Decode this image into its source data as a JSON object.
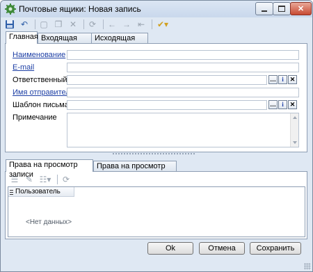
{
  "window": {
    "title": "Почтовые ящики: Новая запись"
  },
  "toolbar": {
    "icons": [
      "save-icon",
      "undo-icon",
      "new-icon",
      "copy-icon",
      "delete-icon",
      "refresh-icon",
      "back-icon",
      "forward-icon",
      "jump-icon",
      "check-icon"
    ]
  },
  "main_tabs": [
    "Главная",
    "Входящая почта",
    "Исходящая почта"
  ],
  "fields": {
    "name_label": "Наименование",
    "email_label": "E-mail",
    "responsible_label": "Ответственный",
    "sender_label": "Имя отправителя",
    "template_label": "Шаблон письма",
    "note_label": "Примечание",
    "values": {
      "name": "",
      "email": "",
      "responsible": "",
      "sender": "",
      "template": "",
      "note": ""
    }
  },
  "lookup_buttons": {
    "ellipsis": "…",
    "info": "i",
    "clear": "✕"
  },
  "detail_tabs": [
    "Права на просмотр записи",
    "Права на просмотр записи"
  ],
  "grid": {
    "column": "Пользователь",
    "empty_text": "<Нет данных>"
  },
  "buttons": {
    "ok": "Ok",
    "cancel": "Отмена",
    "save": "Сохранить"
  },
  "colors": {
    "link": "#1d3fa5",
    "window_bg": "#dfe8f3",
    "close_red": "#c74a32"
  }
}
